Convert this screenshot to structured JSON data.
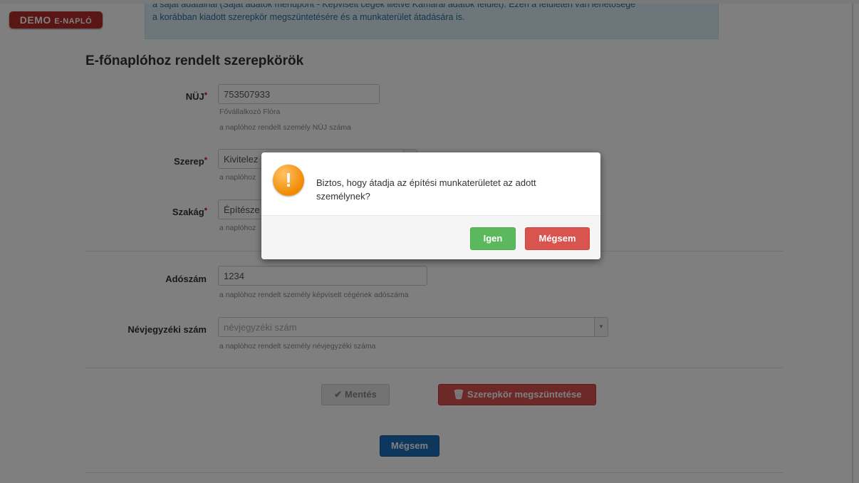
{
  "badge": {
    "prefix": "DEMO",
    "suffix": "E-NAPLÓ"
  },
  "info": {
    "line1": "a saját adatainál (Saját adatok menüpont - Képviselt cégek illetve Kamarai adatok felület). Ezen a felületen van lehetősége",
    "line2": "a korábban kiadott szerepkör megszüntetésére és a munkaterület átadására is."
  },
  "section_title": "E-főnaplóhoz rendelt szerepkörök",
  "form": {
    "nuj": {
      "label": "NÜJ",
      "value": "753507933",
      "help1": "Fővállalkozó Flóra",
      "help2": "a naplóhoz rendelt személy NÜJ száma"
    },
    "szerep": {
      "label": "Szerep",
      "value": "Kivitelez",
      "help": "a naplóhoz"
    },
    "szakag": {
      "label": "Szakág",
      "value": "Építésze",
      "help": "a naplóhoz"
    },
    "adoszam": {
      "label": "Adószám",
      "value": "1234",
      "help": "a naplóhoz rendelt személy képviselt cégének adószáma"
    },
    "nevjegyzeki": {
      "label": "Névjegyzéki szám",
      "placeholder": "névjegyzéki szám",
      "help": "a naplóhoz rendelt személy névjegyzéki száma"
    },
    "required_mark": "*"
  },
  "buttons": {
    "save": "Mentés",
    "delete_role": "Szerepkör megszüntetése",
    "cancel": "Mégsem"
  },
  "modal": {
    "icon": "exclamation-icon",
    "message": "Biztos, hogy átadja az építési munkaterületet az adott személynek?",
    "yes": "Igen",
    "no": "Mégsem"
  },
  "colors": {
    "badge": "#b52a2a",
    "info_bg": "#d9edf7",
    "danger": "#d9534f",
    "success": "#5cb85c",
    "primary": "#1c6fbb",
    "warning": "#f08a00"
  }
}
